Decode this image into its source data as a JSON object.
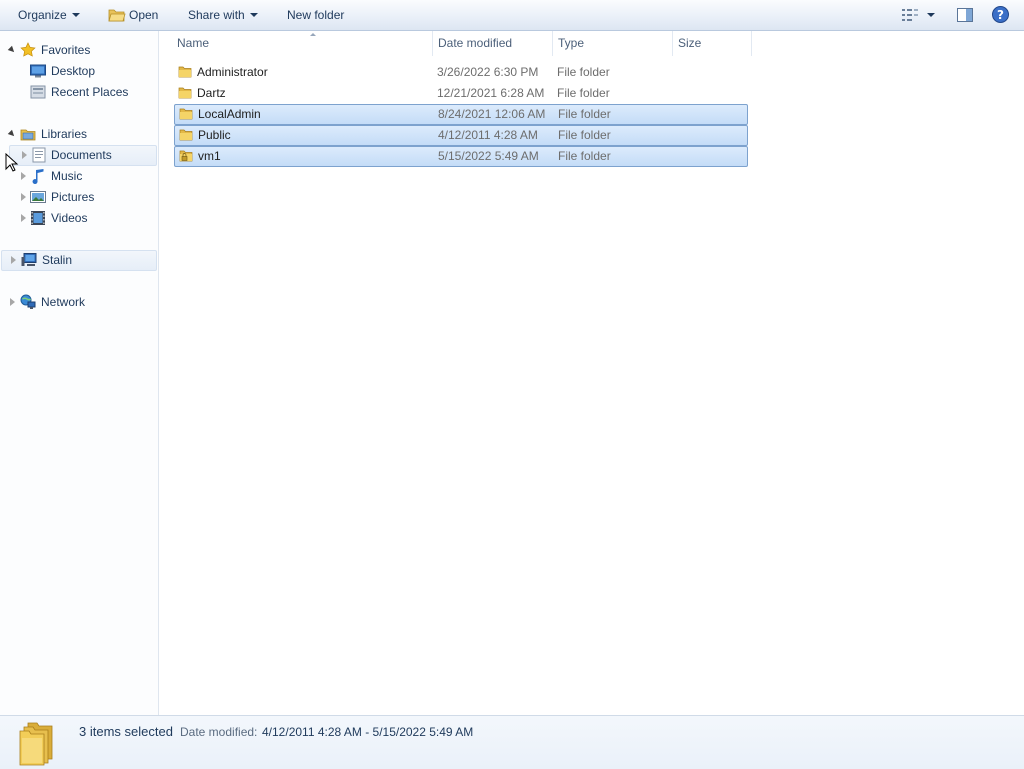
{
  "toolbar": {
    "organize": "Organize",
    "open": "Open",
    "share_with": "Share with",
    "new_folder": "New folder"
  },
  "nav": {
    "favorites": {
      "label": "Favorites",
      "items": [
        {
          "label": "Desktop",
          "icon": "desktop-icon"
        },
        {
          "label": "Recent Places",
          "icon": "recent-places-icon"
        }
      ]
    },
    "libraries": {
      "label": "Libraries",
      "items": [
        {
          "label": "Documents",
          "icon": "documents-icon"
        },
        {
          "label": "Music",
          "icon": "music-icon"
        },
        {
          "label": "Pictures",
          "icon": "pictures-icon"
        },
        {
          "label": "Videos",
          "icon": "videos-icon"
        }
      ]
    },
    "computer": {
      "label": "Stalin",
      "icon": "computer-icon"
    },
    "network": {
      "label": "Network",
      "icon": "network-icon"
    }
  },
  "columns": {
    "name": "Name",
    "date_modified": "Date modified",
    "type": "Type",
    "size": "Size"
  },
  "files": [
    {
      "name": "Administrator",
      "date": "3/26/2022 6:30 PM",
      "type": "File folder",
      "selected": false,
      "icon": "folder-icon"
    },
    {
      "name": "Dartz",
      "date": "12/21/2021 6:28 AM",
      "type": "File folder",
      "selected": false,
      "icon": "folder-icon"
    },
    {
      "name": "LocalAdmin",
      "date": "8/24/2021 12:06 AM",
      "type": "File folder",
      "selected": true,
      "icon": "folder-icon"
    },
    {
      "name": "Public",
      "date": "4/12/2011 4:28 AM",
      "type": "File folder",
      "selected": true,
      "icon": "folder-icon"
    },
    {
      "name": "vm1",
      "date": "5/15/2022 5:49 AM",
      "type": "File folder",
      "selected": true,
      "icon": "locked-folder-icon"
    }
  ],
  "status": {
    "selection": "3 items selected",
    "date_label": "Date modified:",
    "date_range": "4/12/2011 4:28 AM - 5/15/2022 5:49 AM"
  },
  "colors": {
    "selection_fill": "#cce0f8",
    "selection_border": "#7da2ce",
    "folder_yellow": "#f2cd58"
  }
}
